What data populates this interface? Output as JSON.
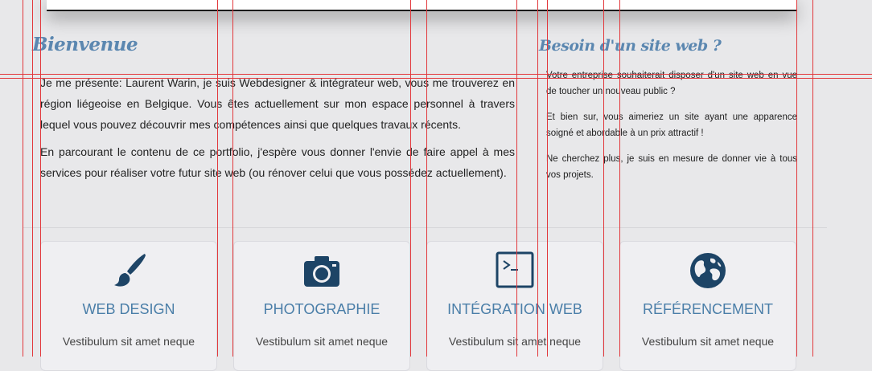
{
  "welcome": {
    "title": "Bienvenue",
    "p1": "Je me présente: Laurent Warin, je suis Webdesigner & intégrateur web, vous me trouverez en région liégeoise en Belgique. Vous êtes actuellement sur mon espace personnel à travers lequel vous pouvez découvrir mes compétences ainsi que quelques travaux récents.",
    "p2": "En parcourant le contenu de ce portfolio, j'espère vous donner l'envie de faire appel à mes services pour réaliser votre futur site web (ou rénover celui que vous possédez actuellement)."
  },
  "aside": {
    "title": "Besoin d'un site web ?",
    "p1": "Votre entreprise souhaiterait disposer d'un site web en vue de toucher un nouveau public ?",
    "p2": "Et bien sur, vous aimeriez un site ayant une apparence soigné et abordable à un prix attractif !",
    "p3": "Ne cherchez plus, je suis en mesure de donner vie à tous vos projets."
  },
  "services": [
    {
      "icon": "paintbrush-icon",
      "title": "WEB DESIGN",
      "text": "Vestibulum sit amet neque"
    },
    {
      "icon": "camera-icon",
      "title": "PHOTOGRAPHIE",
      "text": "Vestibulum sit amet neque"
    },
    {
      "icon": "terminal-icon",
      "title": "INTÉGRATION WEB",
      "text": "Vestibulum sit amet neque"
    },
    {
      "icon": "globe-icon",
      "title": "RÉFÉRENCEMENT",
      "text": "Vestibulum sit amet neque"
    }
  ],
  "colors": {
    "heading": "#5b87b0",
    "icon": "#1d4466",
    "service_title": "#4a7ea8",
    "guide": "#e2383c"
  }
}
